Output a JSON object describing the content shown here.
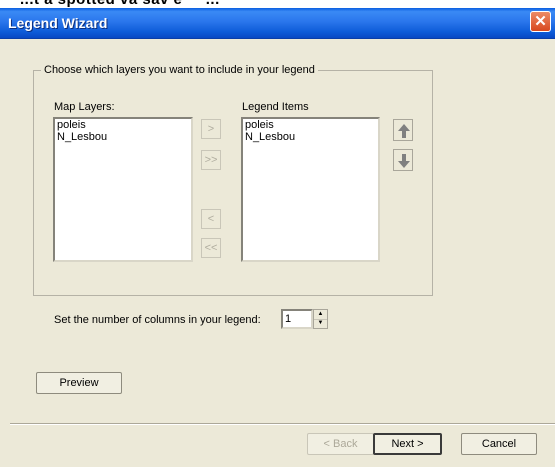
{
  "top_strip_text": "...t a spotted va sav́ é ́ ́ ́ ́ ...",
  "window": {
    "title": "Legend Wizard"
  },
  "group": {
    "caption": "Choose which layers you want to include in your legend",
    "map_layers": {
      "label": "Map Layers:",
      "items": [
        "poleis",
        "N_Lesbou"
      ]
    },
    "legend_items": {
      "label": "Legend Items",
      "items": [
        "poleis",
        "N_Lesbou"
      ]
    },
    "move_buttons": {
      "add_one": ">",
      "add_all": ">>",
      "remove_one": "<",
      "remove_all": "<<"
    },
    "order_buttons": {
      "up_icon": "arrow-up-icon",
      "down_icon": "arrow-down-icon"
    }
  },
  "columns": {
    "label": "Set the number of columns in your legend:",
    "value": "1"
  },
  "buttons": {
    "preview": "Preview",
    "back": "< Back",
    "next": "Next >",
    "cancel": "Cancel"
  },
  "colors": {
    "titlebar": "#0a5ee0",
    "close": "#d8481e",
    "dialog_bg": "#ece9d8"
  }
}
